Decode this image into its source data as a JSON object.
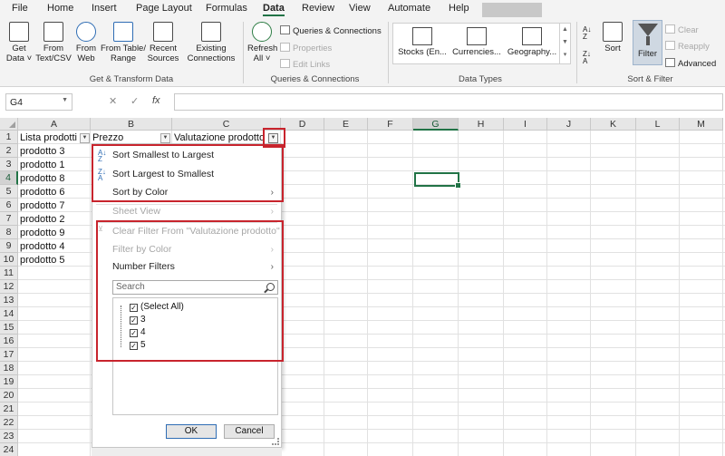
{
  "menu": {
    "tabs": [
      "File",
      "Home",
      "Insert",
      "Page Layout",
      "Formulas",
      "Data",
      "Review",
      "View",
      "Automate",
      "Help"
    ],
    "active_tab": "Data"
  },
  "ribbon": {
    "get_transform": {
      "get_data": "Get\nData ˅",
      "from_text": "From\nText/CSV",
      "from_web": "From\nWeb",
      "from_table": "From Table/\nRange",
      "recent_sources": "Recent\nSources",
      "existing_connections": "Existing\nConnections",
      "label": "Get & Transform Data"
    },
    "queries": {
      "refresh_all": "Refresh\nAll ˅",
      "queries_connections": "Queries & Connections",
      "properties": "Properties",
      "edit_links": "Edit Links",
      "label": "Queries & Connections"
    },
    "data_types": {
      "stocks": "Stocks (En...",
      "currencies": "Currencies...",
      "geography": "Geography...",
      "label": "Data Types"
    },
    "sort_filter": {
      "sort": "Sort",
      "filter": "Filter",
      "clear": "Clear",
      "reapply": "Reapply",
      "advanced": "Advanced",
      "label": "Sort & Filter"
    }
  },
  "formula_bar": {
    "name_box": "G4",
    "cancel": "✕",
    "enter": "✓",
    "fx": "fx",
    "formula": ""
  },
  "grid": {
    "columns": [
      "A",
      "B",
      "C",
      "D",
      "E",
      "F",
      "G",
      "H",
      "I",
      "J",
      "K",
      "L",
      "M"
    ],
    "rows": [
      "1",
      "2",
      "3",
      "4",
      "5",
      "6",
      "7",
      "8",
      "9",
      "10",
      "11",
      "12",
      "13",
      "14",
      "15",
      "16",
      "17",
      "18",
      "19",
      "20",
      "21",
      "22",
      "23",
      "24"
    ],
    "headers": {
      "a1": "Lista prodotti",
      "b1": "Prezzo",
      "c1": "Valutazione prodotto"
    },
    "col_a": [
      "prodotto 3",
      "prodotto 1",
      "prodotto 8",
      "prodotto 6",
      "prodotto 7",
      "prodotto 2",
      "prodotto 9",
      "prodotto 4",
      "prodotto 5"
    ],
    "selected_cell": "G4"
  },
  "filter_menu": {
    "sort_asc": "Sort Smallest to Largest",
    "sort_desc": "Sort Largest to Smallest",
    "sort_color": "Sort by Color",
    "sheet_view": "Sheet View",
    "clear_filter": "Clear Filter From \"Valutazione prodotto\"",
    "filter_color": "Filter by Color",
    "number_filters": "Number Filters",
    "search_placeholder": "Search",
    "items": [
      "(Select All)",
      "3",
      "4",
      "5"
    ],
    "ok": "OK",
    "cancel": "Cancel"
  },
  "colors": {
    "excel_green": "#217346",
    "highlight_red": "#c8242d",
    "ribbon_bg": "#f3f3f3"
  }
}
